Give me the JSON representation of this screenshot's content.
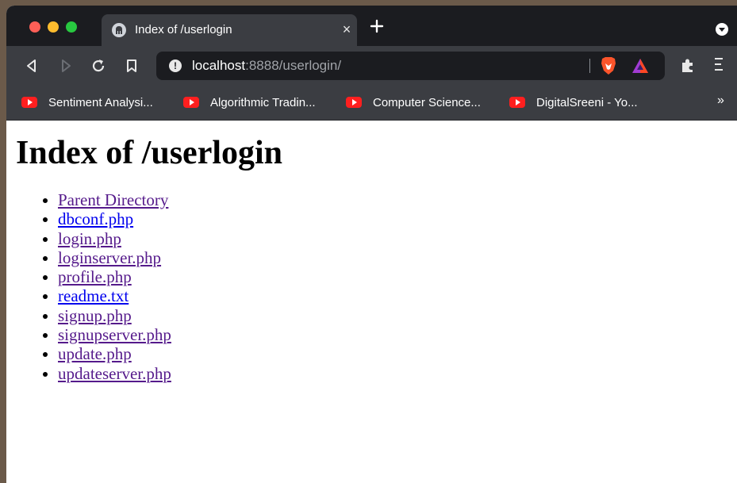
{
  "browser": {
    "tab": {
      "title": "Index of /userlogin",
      "close_label": "×",
      "new_tab_label": "+"
    },
    "address_bar": {
      "host": "localhost",
      "rest": ":8888/userlogin/"
    },
    "icons": {
      "tab_favicon": "server-favicon-icon",
      "back": "back-arrow-icon",
      "forward": "forward-arrow-icon",
      "reload": "reload-icon",
      "bookmark": "bookmark-icon",
      "site_info": "info-icon",
      "brave_shields": "brave-lion-icon",
      "brave_rewards": "rewards-triangle-icon",
      "extensions": "puzzle-piece-icon",
      "menu": "hamburger-menu-icon",
      "youtube": "youtube-icon"
    },
    "bookmarks": [
      {
        "label": "Sentiment Analysi..."
      },
      {
        "label": "Algorithmic Tradin..."
      },
      {
        "label": "Computer Science..."
      },
      {
        "label": "DigitalSreeni - Yo..."
      }
    ],
    "bookmarks_overflow": "»",
    "colors": {
      "chrome_dark": "#1b1c20",
      "toolbar": "#3b3d42",
      "youtube_red": "#ff1f1f",
      "link_visited": "#551a8b",
      "link_unvisited": "#0000ee"
    }
  },
  "page": {
    "title": "Index of /userlogin",
    "items": [
      {
        "label": "Parent Directory",
        "visited": true
      },
      {
        "label": "dbconf.php",
        "visited": false
      },
      {
        "label": "login.php",
        "visited": true
      },
      {
        "label": "loginserver.php",
        "visited": true
      },
      {
        "label": "profile.php",
        "visited": true
      },
      {
        "label": "readme.txt",
        "visited": false
      },
      {
        "label": "signup.php",
        "visited": true
      },
      {
        "label": "signupserver.php",
        "visited": true
      },
      {
        "label": "update.php",
        "visited": true
      },
      {
        "label": "updateserver.php",
        "visited": true
      }
    ]
  }
}
